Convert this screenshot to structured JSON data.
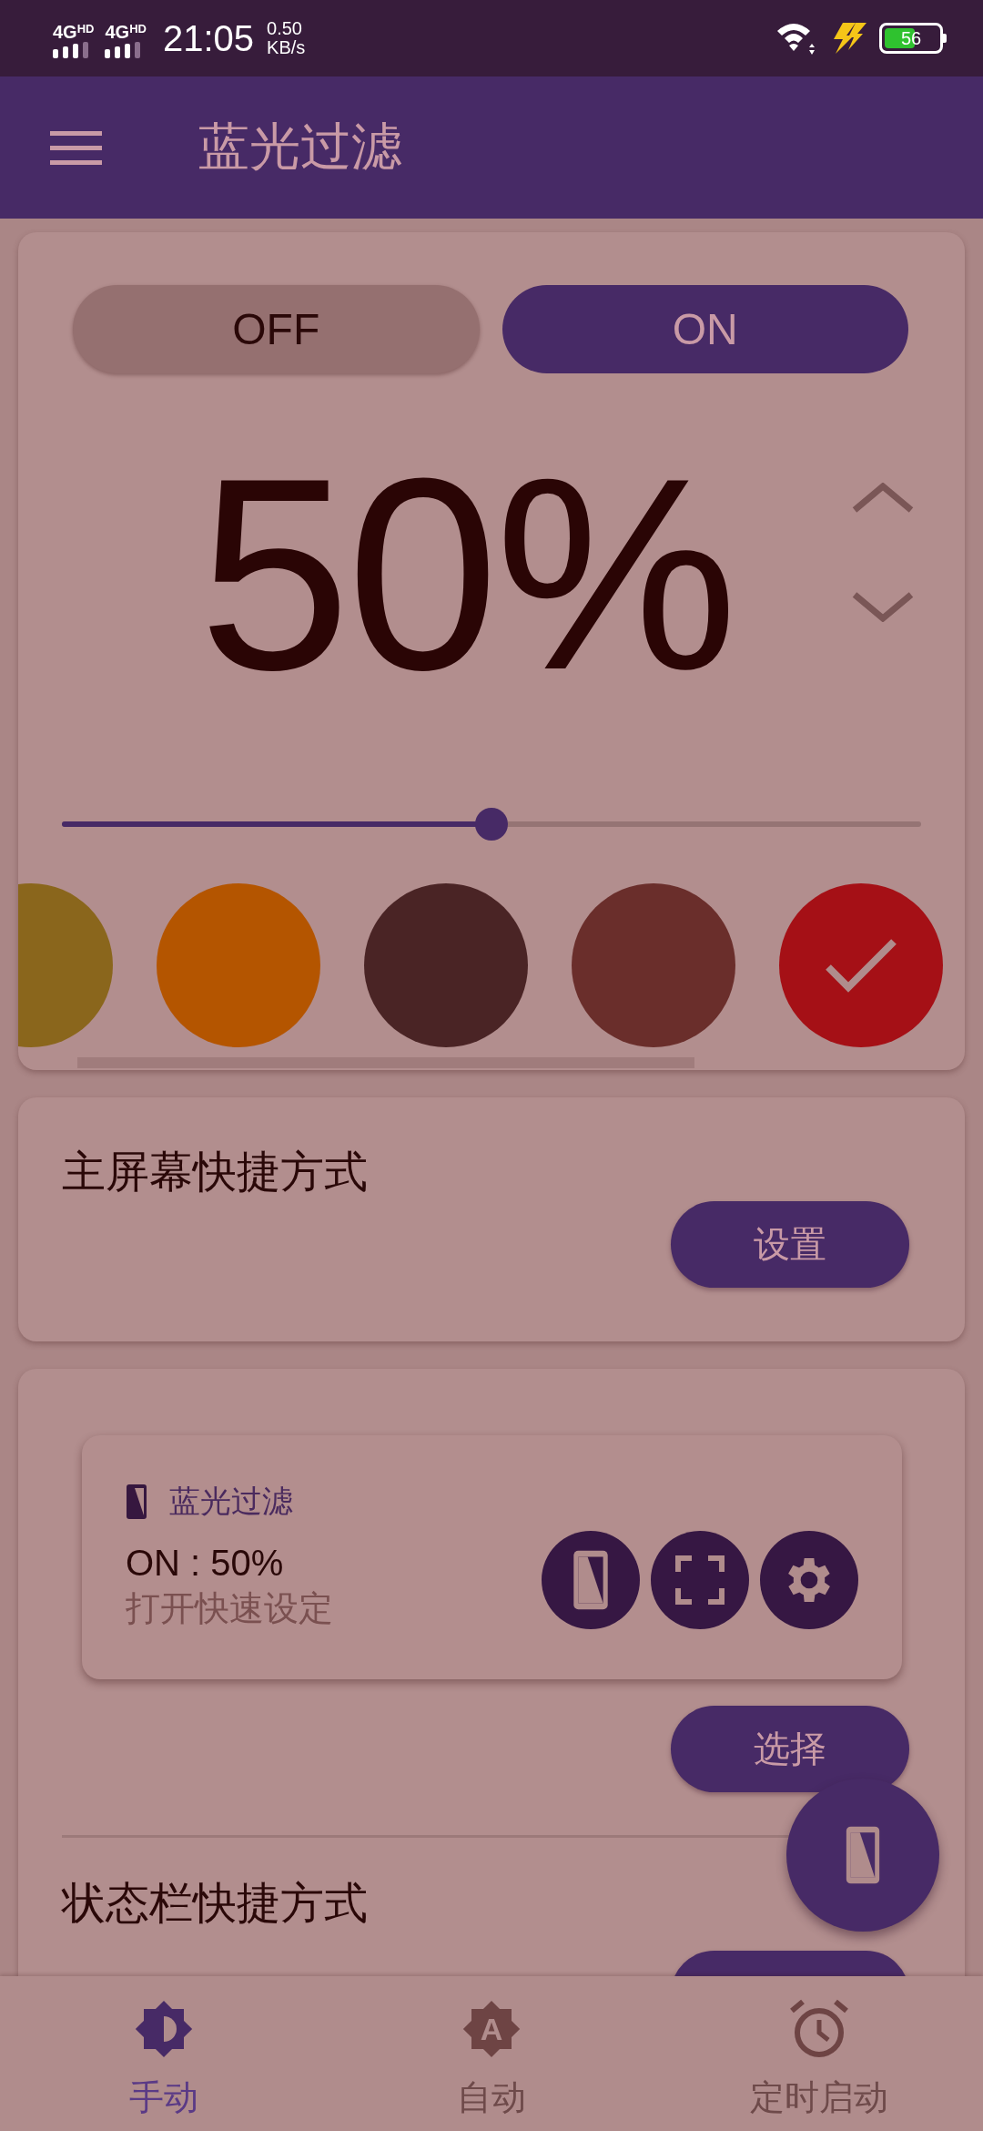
{
  "status_bar": {
    "network_1": "4G$^{HD}$",
    "network_2": "4G$^{HD}$",
    "time": "21:05",
    "speed_value": "0.50",
    "speed_unit": "KB/s",
    "battery": "56"
  },
  "app_bar": {
    "title": "蓝光过滤"
  },
  "filter_card": {
    "toggle": [
      {
        "label": "OFF",
        "selected": false
      },
      {
        "label": "ON",
        "selected": true
      }
    ],
    "percent": "50%",
    "slider": {
      "level": 0.5
    },
    "colors": [
      {
        "color": "#8a661c",
        "selected": false
      },
      {
        "color": "#b45500",
        "selected": false
      },
      {
        "color": "#4a2425",
        "selected": false
      },
      {
        "color": "#6a2e2b",
        "selected": false
      },
      {
        "color": "#a51016",
        "selected": true
      }
    ]
  },
  "home_shortcut": {
    "title": "主屏幕快捷方式",
    "button": "设置"
  },
  "notification_preview": {
    "app_name": "蓝光过滤",
    "status": "ON : 50%",
    "subtitle": "打开快速设定"
  },
  "notification_button": "选择",
  "status_bar_shortcut": {
    "title": "状态栏快捷方式"
  },
  "bottom_nav": [
    {
      "label": "手动",
      "selected": true,
      "kind": "manual"
    },
    {
      "label": "自动",
      "selected": false,
      "kind": "auto",
      "icon_letter": "A"
    },
    {
      "label": "定时启动",
      "selected": false,
      "kind": "timer"
    }
  ]
}
